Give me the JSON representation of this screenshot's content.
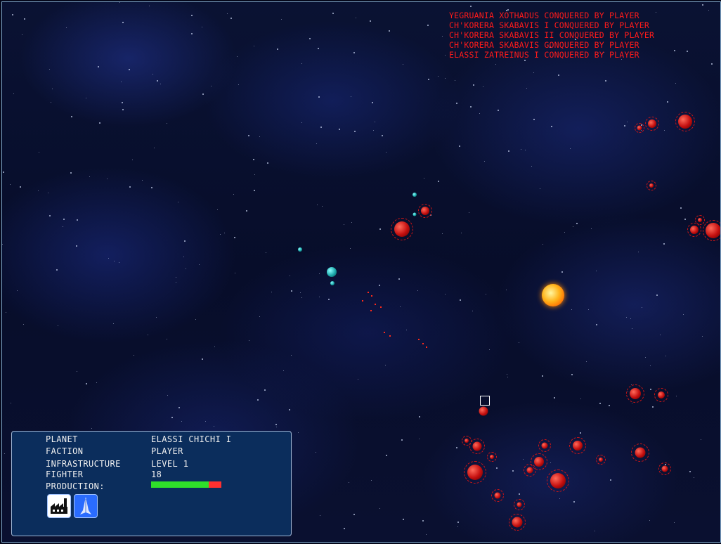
{
  "event_log": [
    "YEGRUANIA XOTHADUS CONQUERED BY PLAYER",
    "CH'KORERA SKABAVIS I CONQUERED BY PLAYER",
    "CH'KORERA SKABAVIS II CONQUERED BY PLAYER",
    "CH'KORERA SKABAVIS GONQUERED BY PLAYER",
    "ELASSI ZATREINUS I CONQUERED BY PLAYER"
  ],
  "info_panel": {
    "planet_label": "PLANET",
    "planet_value": "ELASSI CHICHI I",
    "faction_label": "FACTION",
    "faction_value": "PLAYER",
    "infrastructure_label": "INFRASTRUCTURE",
    "infrastructure_value": "LEVEL 1",
    "fighter_label": "FIGHTER",
    "fighter_value": "18",
    "production_label": "PRODUCTION:",
    "production_progress": 0.82
  },
  "buttons": {
    "factory_icon": "factory-icon",
    "fighter_icon": "fighter-ship-icon"
  },
  "colors": {
    "player_faction": "#d01515",
    "neutral_faction": "#1aa9aa",
    "log_text": "#ff1a1a",
    "panel_bg": "#0b2d5c",
    "progress_fill": "#2fe02a",
    "progress_empty": "#ff3030"
  }
}
